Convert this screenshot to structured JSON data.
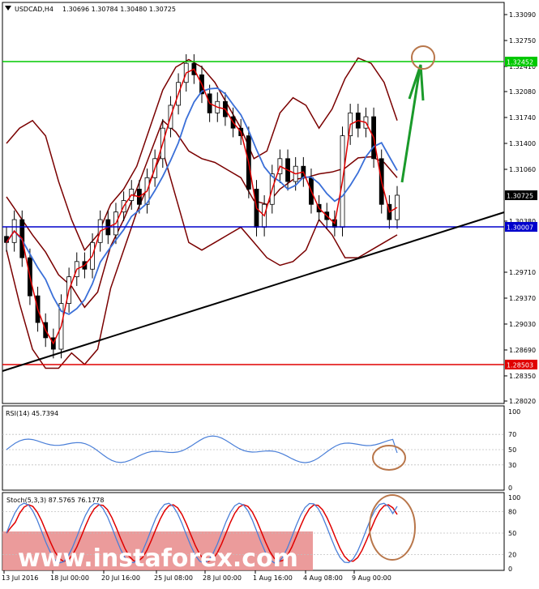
{
  "header": {
    "symbol": "USDCAD,H4",
    "ohlc": "1.30696 1.30784 1.30480 1.30725"
  },
  "price_axis": [
    "1.33090",
    "1.32750",
    "1.32410",
    "1.32080",
    "1.31740",
    "1.31400",
    "1.31060",
    "1.30380",
    "1.29710",
    "1.29370",
    "1.29030",
    "1.28690",
    "1.28350",
    "1.28020"
  ],
  "level_tags": {
    "resistance": "1.32452",
    "current": "1.30725",
    "support": "1.30007",
    "low": "1.28503"
  },
  "colors": {
    "resistance": "#00c800",
    "support": "#0000cc",
    "low": "#e00000",
    "bollinger": "#7a0000",
    "ma_fast": "#e00000",
    "ma_slow": "#3a6fd8",
    "trendline": "#000000",
    "arrow": "#1a9a2a",
    "circle": "#b8764a",
    "rsi_line": "#4a7fd8",
    "stoch_k": "#4a7fd8",
    "stoch_d": "#e00000",
    "watermark_band": "#e88a8a"
  },
  "rsi": {
    "label": "RSI(14) 45.7394",
    "axis": [
      "100",
      "70",
      "50",
      "30",
      "0"
    ]
  },
  "stoch": {
    "label": "Stoch(5,3,3) 87.5765 76.1778",
    "axis": [
      "100",
      "80",
      "50",
      "20",
      "0"
    ]
  },
  "time_axis": [
    "13 Jul 2016",
    "18 Jul 00:00",
    "20 Jul 16:00",
    "25 Jul 08:00",
    "28 Jul 00:00",
    "1 Aug 16:00",
    "4 Aug 08:00",
    "9 Aug 00:00"
  ],
  "watermark": "www.instaforex.com",
  "chart_data": {
    "type": "line",
    "title": "USDCAD,H4",
    "price_range": [
      1.2802,
      1.3309
    ],
    "levels": [
      1.32452,
      1.30007,
      1.28503
    ],
    "last": 1.30725,
    "closes": [
      1.301,
      1.304,
      1.299,
      1.294,
      1.2905,
      1.2885,
      1.287,
      1.293,
      1.2965,
      1.2985,
      1.2975,
      1.301,
      1.304,
      1.302,
      1.305,
      1.3065,
      1.308,
      1.306,
      1.3095,
      1.312,
      1.316,
      1.319,
      1.322,
      1.3245,
      1.323,
      1.3205,
      1.318,
      1.3195,
      1.3175,
      1.316,
      1.315,
      1.308,
      1.303,
      1.306,
      1.31,
      1.312,
      1.309,
      1.311,
      1.3095,
      1.306,
      1.305,
      1.304,
      1.303,
      1.315,
      1.318,
      1.316,
      1.3175,
      1.312,
      1.306,
      1.304,
      1.3072
    ],
    "bollinger_upper": [
      1.314,
      1.316,
      1.317,
      1.315,
      1.309,
      1.304,
      1.3,
      1.302,
      1.306,
      1.308,
      1.311,
      1.316,
      1.321,
      1.324,
      1.325,
      1.324,
      1.322,
      1.319,
      1.316,
      1.312,
      1.313,
      1.318,
      1.32,
      1.319,
      1.316,
      1.3185,
      1.3225,
      1.3252,
      1.3245,
      1.322,
      1.317
    ],
    "bollinger_lower": [
      1.3,
      1.293,
      1.287,
      1.2845,
      1.2845,
      1.2865,
      1.285,
      1.287,
      1.295,
      1.3,
      1.305,
      1.309,
      1.313,
      1.307,
      1.301,
      1.3,
      1.301,
      1.302,
      1.303,
      1.301,
      1.299,
      1.298,
      1.2985,
      1.3,
      1.304,
      1.302,
      1.299,
      1.299,
      1.3,
      1.301,
      1.302
    ],
    "rsi_value": 45.7394,
    "stoch_k": 87.5765,
    "stoch_d": 76.1778
  }
}
